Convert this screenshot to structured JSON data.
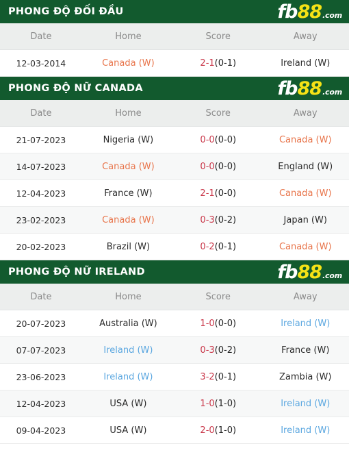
{
  "brand": {
    "fb": "fb",
    "eighty_eight": "88",
    "dot_com": ".com",
    "yellow": "#f5e216",
    "green": "#125a2e"
  },
  "colors": {
    "header_green": "#125a2e",
    "score_red": "#c9384a",
    "canada_orange": "#e8744a",
    "ireland_blue": "#5ba7e0",
    "col_header_bg": "#eceeed"
  },
  "columns": {
    "date": "Date",
    "home": "Home",
    "score": "Score",
    "away": "Away"
  },
  "sections": [
    {
      "title": "PHONG ĐỘ ĐỐI ĐẦU",
      "rows": [
        {
          "date": "12-03-2014",
          "home": "Canada (W)",
          "home_hl": "orange",
          "score_main": "2-1",
          "score_ht": "(0-1)",
          "away": "Ireland (W)",
          "away_hl": "none"
        }
      ]
    },
    {
      "title": "PHONG ĐỘ NỮ CANADA",
      "rows": [
        {
          "date": "21-07-2023",
          "home": "Nigeria (W)",
          "home_hl": "none",
          "score_main": "0-0",
          "score_ht": "(0-0)",
          "away": "Canada (W)",
          "away_hl": "orange"
        },
        {
          "date": "14-07-2023",
          "home": "Canada (W)",
          "home_hl": "orange",
          "score_main": "0-0",
          "score_ht": "(0-0)",
          "away": "England (W)",
          "away_hl": "none"
        },
        {
          "date": "12-04-2023",
          "home": "France (W)",
          "home_hl": "none",
          "score_main": "2-1",
          "score_ht": "(0-0)",
          "away": "Canada (W)",
          "away_hl": "orange"
        },
        {
          "date": "23-02-2023",
          "home": "Canada (W)",
          "home_hl": "orange",
          "score_main": "0-3",
          "score_ht": "(0-2)",
          "away": "Japan (W)",
          "away_hl": "none"
        },
        {
          "date": "20-02-2023",
          "home": "Brazil (W)",
          "home_hl": "none",
          "score_main": "0-2",
          "score_ht": "(0-1)",
          "away": "Canada (W)",
          "away_hl": "orange"
        }
      ]
    },
    {
      "title": "PHONG ĐỘ NỮ IRELAND",
      "rows": [
        {
          "date": "20-07-2023",
          "home": "Australia (W)",
          "home_hl": "none",
          "score_main": "1-0",
          "score_ht": "(0-0)",
          "away": "Ireland (W)",
          "away_hl": "blue"
        },
        {
          "date": "07-07-2023",
          "home": "Ireland (W)",
          "home_hl": "blue",
          "score_main": "0-3",
          "score_ht": "(0-2)",
          "away": "France (W)",
          "away_hl": "none"
        },
        {
          "date": "23-06-2023",
          "home": "Ireland (W)",
          "home_hl": "blue",
          "score_main": "3-2",
          "score_ht": "(0-1)",
          "away": "Zambia (W)",
          "away_hl": "none"
        },
        {
          "date": "12-04-2023",
          "home": "USA (W)",
          "home_hl": "none",
          "score_main": "1-0",
          "score_ht": "(1-0)",
          "away": "Ireland (W)",
          "away_hl": "blue"
        },
        {
          "date": "09-04-2023",
          "home": "USA (W)",
          "home_hl": "none",
          "score_main": "2-0",
          "score_ht": "(1-0)",
          "away": "Ireland (W)",
          "away_hl": "blue"
        }
      ]
    }
  ]
}
